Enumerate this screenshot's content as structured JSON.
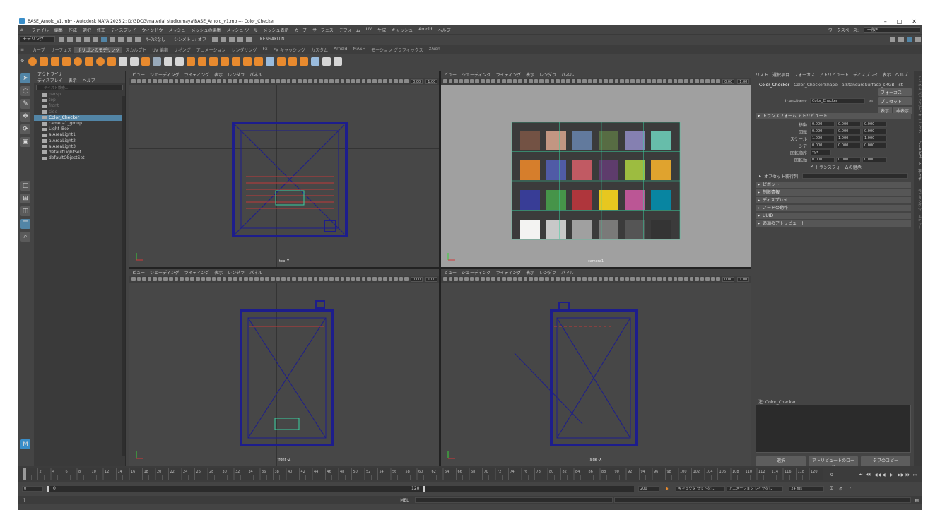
{
  "window": {
    "title": "BASE_Arnold_v1.mb* - Autodesk MAYA 2025.2: D:\\3DCG\\material studio\\maya\\BASE_Arnold_v1.mb  ---  Color_Checker",
    "minimize": "–",
    "maximize": "□",
    "close": "✕"
  },
  "menubar": {
    "items": [
      "ファイル",
      "編集",
      "作成",
      "選択",
      "修正",
      "ディスプレイ",
      "ウィンドウ",
      "メッシュ",
      "メッシュの編集",
      "メッシュ ツール",
      "メッシュ表示",
      "カーブ",
      "サーフェス",
      "デフォーム",
      "UV",
      "生成",
      "キャッシュ",
      "Arnold",
      "ヘルプ"
    ],
    "workspace_label": "ワークスペース:",
    "workspace_value": "一般*"
  },
  "toolbar": {
    "mode": "モデリング",
    "symmetry": "シンメトリ: オフ",
    "live": "ｻｰﾌｪｽなし",
    "user": "KENSAKU N"
  },
  "shelf": {
    "tabs": [
      "カーブ",
      "サーフェス",
      "ポリゴンのモデリング",
      "スカルプト",
      "UV 編集",
      "リギング",
      "アニメーション",
      "レンダリング",
      "Fx",
      "FX キャッシング",
      "カスタム",
      "Arnold",
      "MASH",
      "モーション グラフィックス",
      "XGen"
    ],
    "active": 2
  },
  "outliner": {
    "title": "アウトライナ",
    "menu": [
      "ディスプレイ",
      "表示",
      "ヘルプ"
    ],
    "search_placeholder": "テキスト検索...",
    "items": [
      {
        "label": "persp",
        "dim": true
      },
      {
        "label": "top",
        "dim": true
      },
      {
        "label": "front",
        "dim": true
      },
      {
        "label": "side",
        "dim": true
      },
      {
        "label": "Color_Checker",
        "selected": true
      },
      {
        "label": "camera1_group"
      },
      {
        "label": "Light_Box"
      },
      {
        "label": "aiAreaLight1"
      },
      {
        "label": "aiAreaLight2"
      },
      {
        "label": "aiAreaLight3"
      },
      {
        "label": "defaultLightSet"
      },
      {
        "label": "defaultObjectSet"
      }
    ]
  },
  "viewport": {
    "menu": [
      "ビュー",
      "シェーディング",
      "ライティング",
      "表示",
      "レンダラ",
      "パネル"
    ],
    "values": [
      "0.00",
      "1.00"
    ],
    "panels": {
      "tl": "top -Y",
      "tr": "camera1",
      "bl": "front -Z",
      "br": "side -X"
    }
  },
  "checker": {
    "colors": [
      "#735244",
      "#c29682",
      "#627a9d",
      "#576c43",
      "#8580b1",
      "#67bdaa",
      "#d67e2c",
      "#505ba6",
      "#c15a63",
      "#5e3c6c",
      "#9dbc40",
      "#e0a32e",
      "#383d96",
      "#469449",
      "#af363c",
      "#e7c71f",
      "#bb5695",
      "#0885a1",
      "#f3f3f2",
      "#c8c8c8",
      "#a0a0a0",
      "#7a7a79",
      "#555555",
      "#343434"
    ]
  },
  "attr": {
    "menu": [
      "リスト",
      "選択項目",
      "フォーカス",
      "アトリビュート",
      "ディスプレイ",
      "表示",
      "ヘルプ"
    ],
    "tabs": [
      "Color_Checker",
      "Color_CheckerShape",
      "aiStandardSurface_sRGB",
      "st"
    ],
    "transform_label": "transform:",
    "transform_value": "Color_Checker",
    "btn_focus": "フォーカス",
    "btn_preset": "プリセット",
    "btn_show": "表示",
    "btn_hide": "非表示",
    "section_transform": "トランスフォーム アトリビュート",
    "rows": [
      {
        "label": "移動",
        "v": [
          "0.000",
          "0.000",
          "0.000"
        ]
      },
      {
        "label": "回転",
        "v": [
          "0.000",
          "0.000",
          "0.000"
        ]
      },
      {
        "label": "スケール",
        "v": [
          "1.000",
          "1.000",
          "1.000"
        ]
      },
      {
        "label": "シア",
        "v": [
          "0.000",
          "0.000",
          "0.000"
        ]
      }
    ],
    "rotate_order_label": "回転順序",
    "rotate_order": "xyz",
    "rotate_axis_label": "回転軸",
    "rotate_axis": [
      "0.000",
      "0.000",
      "0.000"
    ],
    "inherit": "トランスフォームの継承",
    "offset_label": "オフセット親行列",
    "sections": [
      "ピボット",
      "制限情報",
      "ディスプレイ",
      "ノードの動作",
      "UUID",
      "追加のアトリビュート"
    ],
    "notes_label": "注: Color_Checker",
    "buttons": [
      "選択",
      "アトリビュートのロード",
      "タブのコピー"
    ]
  },
  "rightstrip": {
    "labels": [
      "チャネル ボックス/レイヤ エディタ",
      "アトリビュート エディタ",
      "モデリング ツールキット"
    ]
  },
  "timeline": {
    "ticks": [
      "2",
      "4",
      "6",
      "8",
      "10",
      "12",
      "14",
      "16",
      "18",
      "20",
      "22",
      "24",
      "26",
      "28",
      "30",
      "32",
      "34",
      "36",
      "38",
      "40",
      "42",
      "44",
      "46",
      "48",
      "50",
      "52",
      "54",
      "56",
      "58",
      "60",
      "62",
      "64",
      "66",
      "68",
      "70",
      "72",
      "74",
      "76",
      "78",
      "80",
      "82",
      "84",
      "86",
      "88",
      "90",
      "92",
      "94",
      "96",
      "98",
      "100",
      "102",
      "104",
      "106",
      "108",
      "110",
      "112",
      "114",
      "116",
      "118",
      "120"
    ],
    "current": "0"
  },
  "range": {
    "start": "0",
    "inner_start": "0",
    "inner_end": "120",
    "end": "200",
    "char_set": "キャラクタ セットなし",
    "anim_layer": "アニメーション レイヤなし",
    "fps": "24 fps"
  },
  "cmdline": {
    "label": "MEL"
  }
}
